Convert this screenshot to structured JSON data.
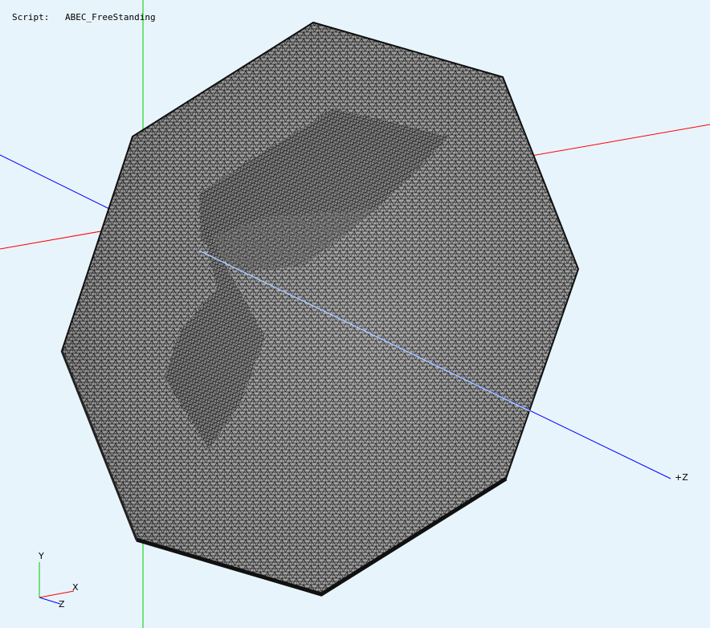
{
  "header": {
    "script_label": "Script:",
    "script_value": "ABEC_FreeStanding"
  },
  "scene": {
    "axis_label_z": "+Z",
    "triad": {
      "y_label": "Y",
      "x_label": "X",
      "z_label": "Z"
    }
  },
  "colors": {
    "background": "#e8f4fc",
    "x_axis": "#ff0000",
    "y_axis": "#00cc00",
    "z_axis": "#0000ff",
    "mesh_fill": "#a8a8a8",
    "mesh_edge": "#111111"
  }
}
